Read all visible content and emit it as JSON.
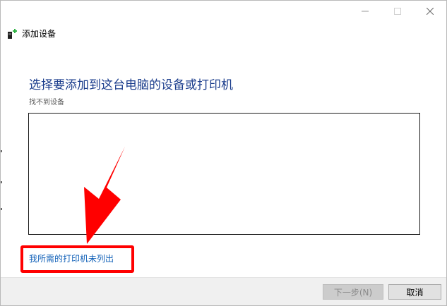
{
  "window": {
    "title": "添加设备",
    "controls": {
      "minimize_icon": "minimize-icon",
      "maximize_icon": "maximize-icon",
      "close_icon": "close-icon"
    }
  },
  "main": {
    "heading": "选择要添加到这台电脑的设备或打印机",
    "status": "找不到设备",
    "device_list": []
  },
  "link": {
    "printer_not_listed": "我所需的打印机未列出"
  },
  "footer": {
    "next_label": "下一步(N)",
    "cancel_label": "取消"
  },
  "annotation": {
    "highlight_color": "#ff0000",
    "arrow_color": "#ff0000"
  },
  "colors": {
    "heading": "#1a3c8c",
    "link": "#1060b8",
    "icon_green": "#2fb344"
  }
}
